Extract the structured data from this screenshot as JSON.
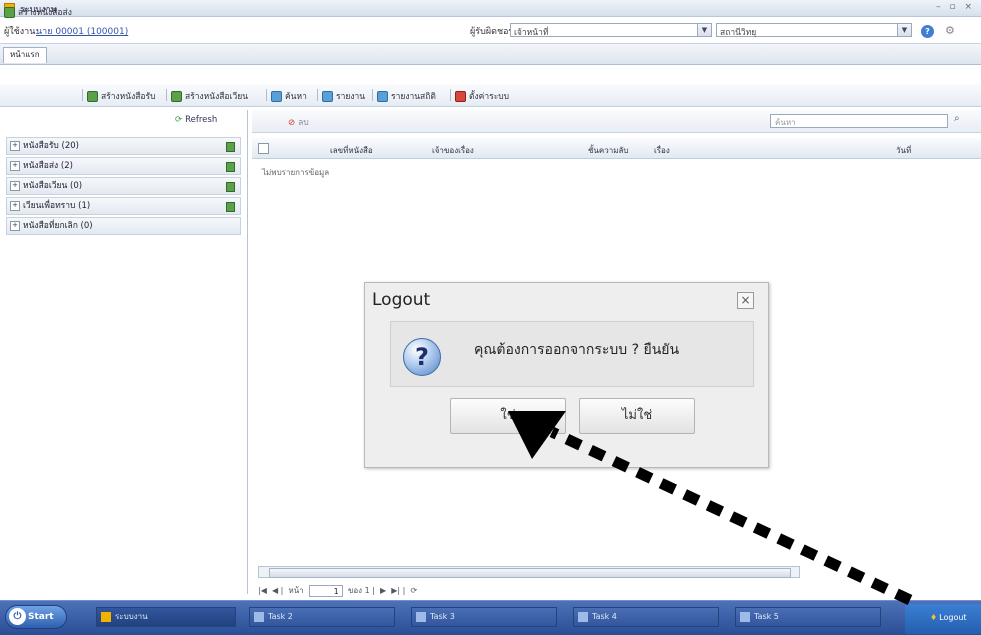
{
  "window": {
    "title": "ระบบงาน"
  },
  "header": {
    "user_label": "ผู้ใช้งาน:",
    "user_id": "นาย 00001 (100001)",
    "location_label": "ผู้รับผิดชอบ:",
    "location_value": "เจ้าหน้าที่",
    "dept_value": "สถานีวิทยุ"
  },
  "tabs": [
    {
      "label": "หน้าแรก"
    }
  ],
  "toolbar": {
    "items": [
      {
        "label": "สร้างหนังสือส่ง",
        "icon": "g"
      },
      {
        "label": "สร้างหนังสือรับ",
        "icon": "g"
      },
      {
        "label": "สร้างหนังสือเวียน",
        "icon": "g"
      },
      {
        "label": "ค้นหา",
        "icon": "b"
      },
      {
        "label": "รายงาน",
        "icon": "b"
      },
      {
        "label": "รายงานสถิติ",
        "icon": "b"
      },
      {
        "label": "ตั้งค่าระบบ",
        "icon": "r"
      }
    ]
  },
  "sidebar": {
    "refresh_label": "Refresh",
    "folders": [
      {
        "label": "หนังสือรับ (20)"
      },
      {
        "label": "หนังสือส่ง (2)"
      },
      {
        "label": "หนังสือเวียน (0)"
      },
      {
        "label": "เวียนเพื่อทราบ (1)"
      },
      {
        "label": "หนังสือที่ยกเลิก (0)"
      }
    ]
  },
  "grid": {
    "delete_label": "ลบ",
    "search_placeholder": "ค้นหา",
    "columns": [
      "เลขที่หนังสือ",
      "เจ้าของเรื่อง",
      "ชั้นความลับ",
      "เรื่อง",
      "วันที่"
    ],
    "empty_text": "ไม่พบรายการข้อมูล",
    "pager": {
      "page_label": "หน้า",
      "page_value": "1",
      "of_label": "ของ 1"
    }
  },
  "dialog": {
    "title": "Logout",
    "message": "คุณต้องการออกจากระบบ ? ยืนยัน",
    "yes_label": "ใช่",
    "no_label": "ไม่ใช่"
  },
  "taskbar": {
    "start_label": "Start",
    "tasks": [
      {
        "label": "ระบบงาน",
        "active": true
      },
      {
        "label": "Task 2",
        "active": false
      },
      {
        "label": "Task 3",
        "active": false
      },
      {
        "label": "Task 4",
        "active": false
      },
      {
        "label": "Task 5",
        "active": false
      }
    ],
    "tray_label": "Logout"
  }
}
